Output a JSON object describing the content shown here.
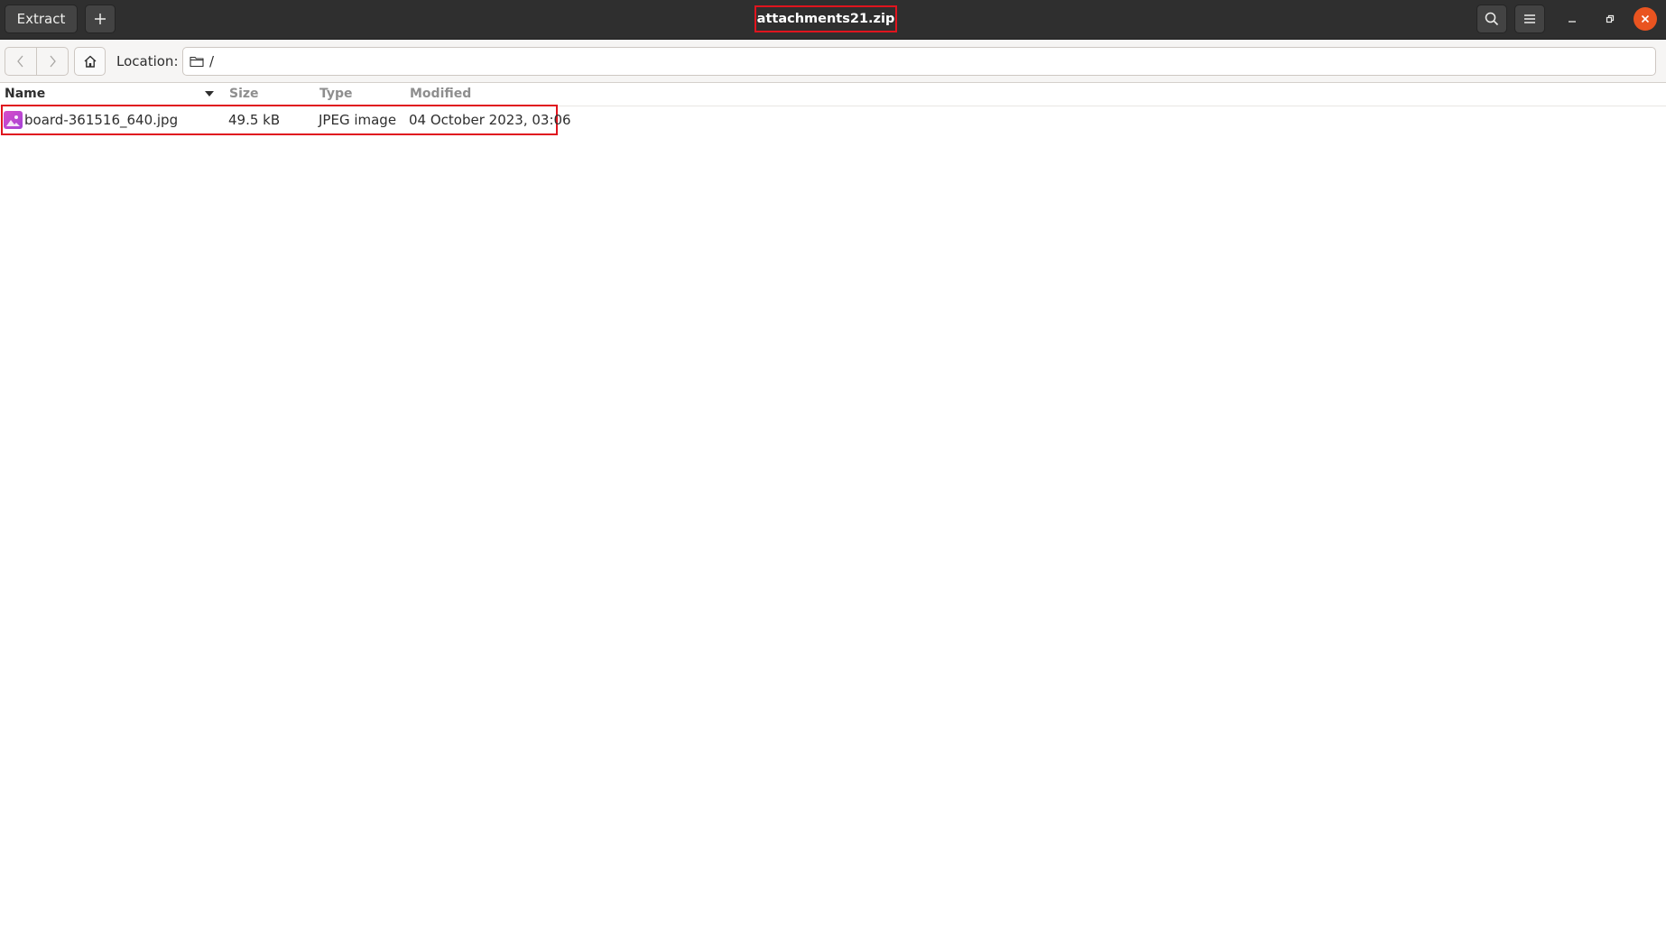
{
  "header": {
    "extract_label": "Extract",
    "title": "attachments21.zip"
  },
  "toolbar": {
    "location_label": "Location:",
    "location_path": "/"
  },
  "columns": {
    "name": "Name",
    "size": "Size",
    "type": "Type",
    "modified": "Modified"
  },
  "files": [
    {
      "name": "board-361516_640.jpg",
      "size": "49.5 kB",
      "type": "JPEG image",
      "modified": "04 October 2023, 03:06",
      "icon": "image-file-icon"
    }
  ],
  "colors": {
    "headerbar": "#2f2f2f",
    "close_button": "#e95420",
    "highlight_box": "#e0141e"
  }
}
